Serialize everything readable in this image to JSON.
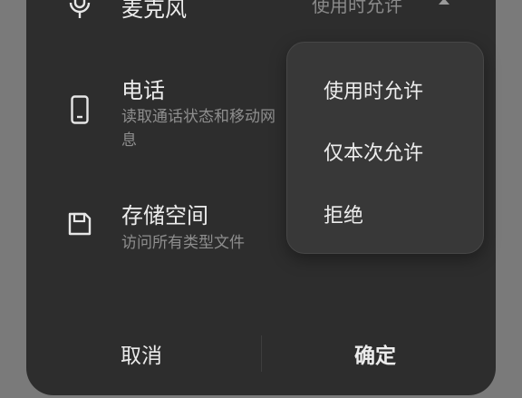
{
  "permissions": [
    {
      "title": "麦克风",
      "status": "使用时允许",
      "icon": "microphone-icon"
    },
    {
      "title": "电话",
      "description": "读取通话状态和移动网",
      "description_line2": "息",
      "icon": "phone-icon"
    },
    {
      "title": "存储空间",
      "description": "访问所有类型文件",
      "icon": "storage-icon"
    }
  ],
  "dropdown": {
    "options": [
      "使用时允许",
      "仅本次允许",
      "拒绝"
    ]
  },
  "footer": {
    "cancel_label": "取消",
    "confirm_label": "确定"
  },
  "colors": {
    "sheet_bg": "#2d2d2d",
    "dropdown_bg": "#383838",
    "scrim": "#7a7a7a"
  }
}
